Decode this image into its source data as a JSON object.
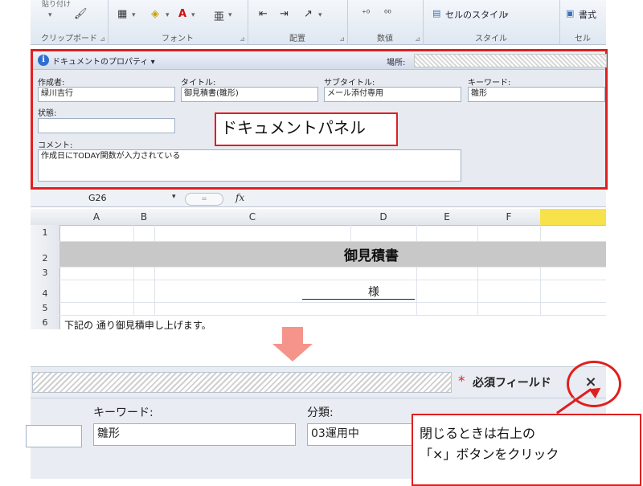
{
  "ribbon": {
    "paste_label": "貼り付け",
    "groups": {
      "clipboard": "クリップボード",
      "font": "フォント",
      "alignment": "配置",
      "number": "数値",
      "style": "スタイル",
      "cells": "セル"
    },
    "cell_style_label": "セルのスタイル",
    "format_label": "書式"
  },
  "doc_panel": {
    "title": "ドキュメントのプロパティ",
    "location_label": "場所:",
    "fields": {
      "author_label": "作成者:",
      "author_value": "緑川吉行",
      "title_label": "タイトル:",
      "title_value": "御見積書(雛形)",
      "subject_label": "サブタイトル:",
      "subject_value": "メール添付専用",
      "keywords_label": "キーワード:",
      "keywords_value": "雛形",
      "status_label": "状態:",
      "status_value": "",
      "comments_label": "コメント:",
      "comments_value": "作成日にTODAY関数が入力されている"
    },
    "callout": "ドキュメントパネル"
  },
  "formula_bar": {
    "name_box": "G26",
    "fx": "fx"
  },
  "sheet": {
    "columns": [
      "A",
      "B",
      "C",
      "D",
      "E",
      "F"
    ],
    "rows": [
      "1",
      "2",
      "3",
      "4",
      "5",
      "6"
    ],
    "d2": "御見積書",
    "d4": "様",
    "a6": "下記の 通り御見積申し上げます。"
  },
  "zoom": {
    "required_star": "*",
    "required_label": "必須フィールド",
    "close": "×",
    "keywords_label": "キーワード:",
    "keywords_value": "雛形",
    "category_label": "分類:",
    "category_value": "03運用中",
    "instruction_line1": "閉じるときは右上の",
    "instruction_line2": "「×」ボタンをクリック"
  },
  "colors": {
    "accent_red": "#e01f1f",
    "arrow": "#f5948a",
    "selected_column": "#f7e24c"
  }
}
